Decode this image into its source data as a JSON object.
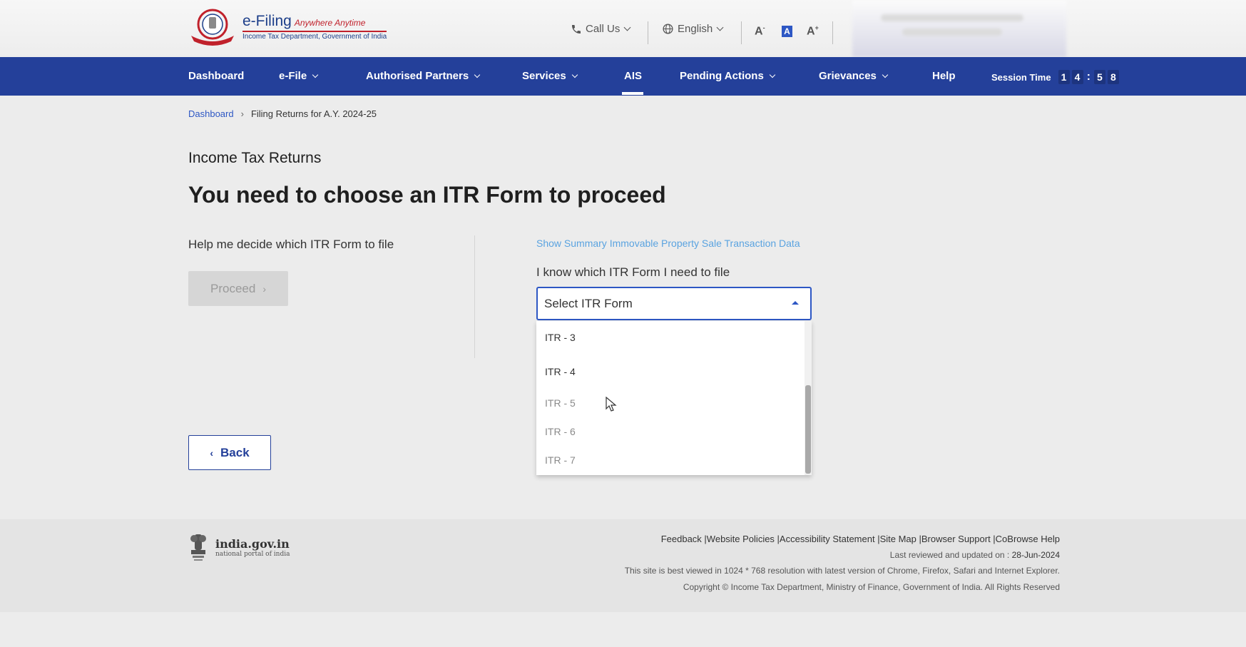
{
  "header": {
    "logo_title": "e-Filing",
    "logo_tagline": "Anywhere Anytime",
    "logo_subtitle": "Income Tax Department, Government of India",
    "call_us": "Call Us",
    "language": "English",
    "font_decrease": "A",
    "font_reset": "A",
    "font_increase": "A",
    "icons": [
      "phone-icon",
      "globe-icon",
      "chevron-down-icon"
    ]
  },
  "nav": {
    "items": [
      {
        "label": "Dashboard",
        "has_menu": false
      },
      {
        "label": "e-File",
        "has_menu": true
      },
      {
        "label": "Authorised Partners",
        "has_menu": true
      },
      {
        "label": "Services",
        "has_menu": true
      },
      {
        "label": "AIS",
        "has_menu": false,
        "active": true
      },
      {
        "label": "Pending Actions",
        "has_menu": true
      },
      {
        "label": "Grievances",
        "has_menu": true
      },
      {
        "label": "Help",
        "has_menu": false
      }
    ],
    "session_label": "Session Time",
    "session_digits": [
      "1",
      "4",
      "5",
      "8"
    ]
  },
  "breadcrumb": {
    "home": "Dashboard",
    "current": "Filing Returns for A.Y. 2024-25"
  },
  "main": {
    "section_title": "Income Tax Returns",
    "page_title": "You need to choose an ITR Form to proceed",
    "help_text": "Help me decide which ITR Form to file",
    "proceed_label": "Proceed",
    "summary_link": "Show Summary Immovable Property Sale Transaction Data",
    "know_text": "I know which ITR Form I need to file",
    "select_placeholder": "Select ITR Form",
    "options": [
      "ITR - 3",
      "ITR - 4",
      "ITR - 5",
      "ITR - 6",
      "ITR - 7"
    ],
    "back_label": "Back"
  },
  "footer": {
    "gov_name": "india.gov.in",
    "gov_sub": "national portal of india",
    "links": "Feedback |Website Policies |Accessibility Statement |Site Map |Browser Support |CoBrowse Help",
    "reviewed_label": "Last reviewed and updated on :",
    "reviewed_date": "28-Jun-2024",
    "best_viewed": "This site is best viewed in 1024 * 768 resolution with latest version of Chrome, Firefox, Safari and Internet Explorer.",
    "copyright": "Copyright © Income Tax Department, Ministry of Finance, Government of India. All Rights Reserved"
  },
  "colors": {
    "nav_bg": "#24409a",
    "link": "#2d57c4",
    "summary_link": "#5aa3e0",
    "logo_red": "#c0212b"
  }
}
